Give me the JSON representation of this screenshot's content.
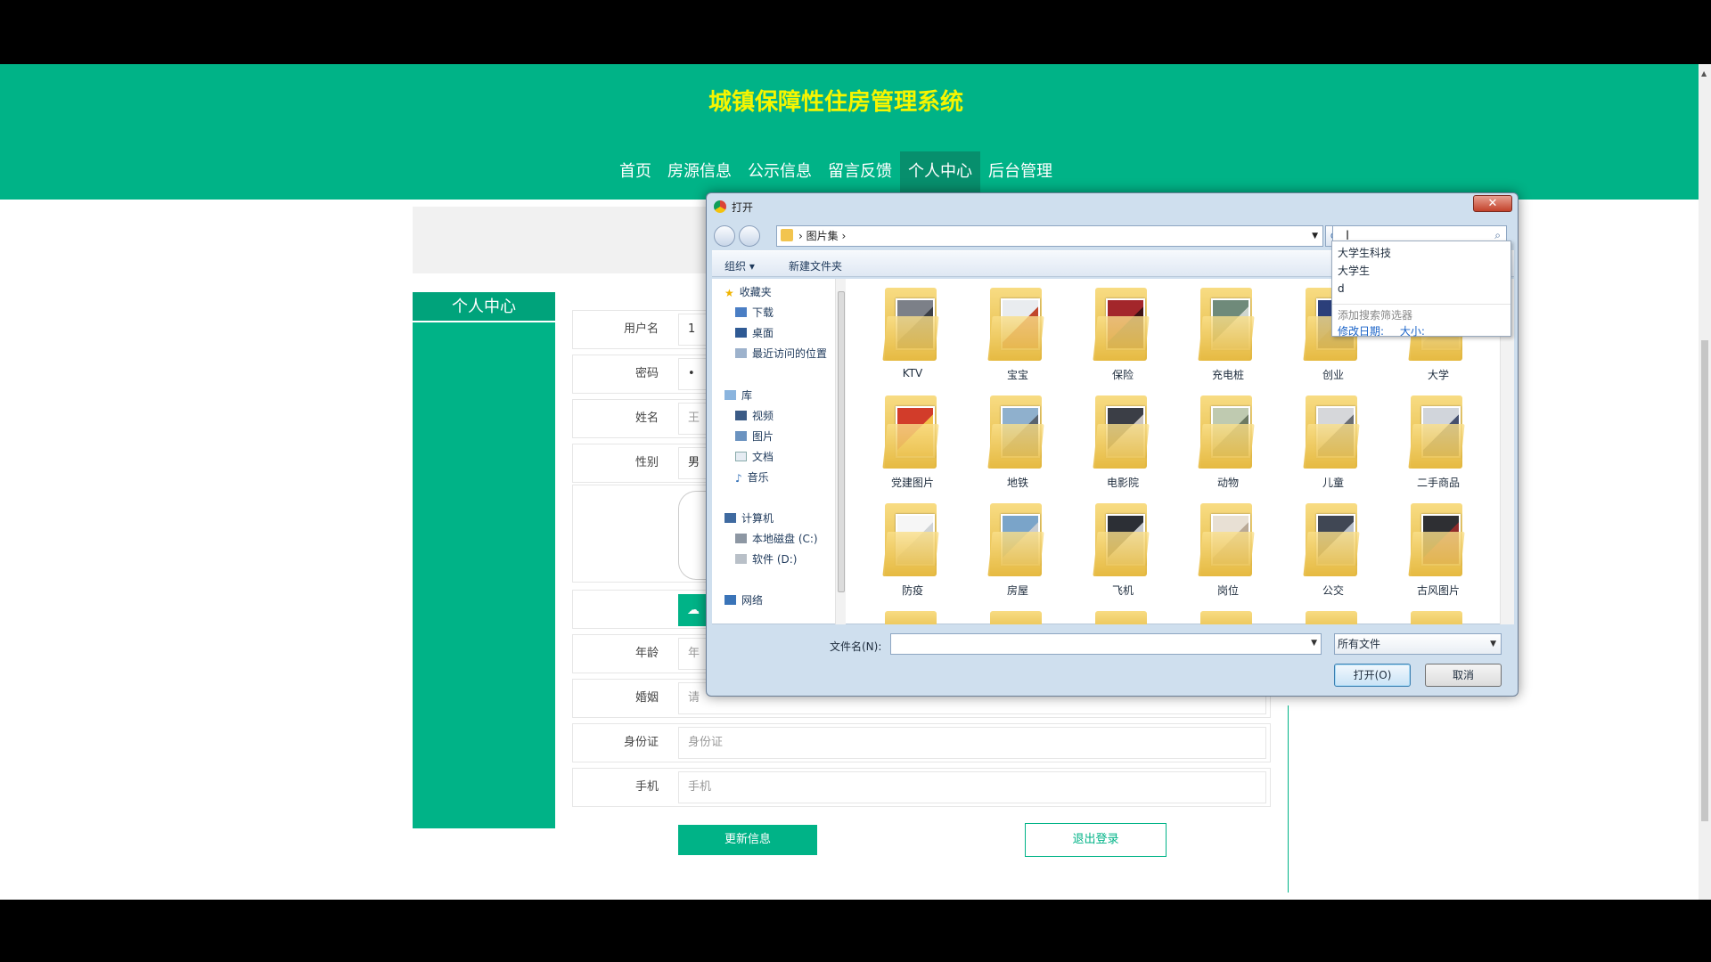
{
  "site": {
    "title": "城镇保障性住房管理系统",
    "nav": [
      "首页",
      "房源信息",
      "公示信息",
      "留言反馈",
      "个人中心",
      "后台管理"
    ]
  },
  "sidebar": {
    "title": "个人中心"
  },
  "form": {
    "rows": [
      {
        "label": "用户名",
        "value": "1"
      },
      {
        "label": "密码",
        "value": "•"
      },
      {
        "label": "姓名",
        "value": "王"
      },
      {
        "label": "性别",
        "value": "男"
      },
      {
        "label": "年龄",
        "value": "年"
      },
      {
        "label": "婚姻",
        "value": "请"
      },
      {
        "label": "身份证",
        "value": "身份证"
      },
      {
        "label": "手机",
        "value": "手机"
      }
    ],
    "update_label": "更新信息",
    "logout_label": "退出登录"
  },
  "dialog": {
    "title": "打开",
    "breadcrumb": "图片集",
    "toolbar": {
      "organize": "组织 ▾",
      "new_folder": "新建文件夹"
    },
    "nav_groups": [
      {
        "label": "收藏夹",
        "items": [
          "下载",
          "桌面",
          "最近访问的位置"
        ]
      },
      {
        "label": "库",
        "items": [
          "视频",
          "图片",
          "文档",
          "音乐"
        ]
      },
      {
        "label": "计算机",
        "items": [
          "本地磁盘 (C:)",
          "软件 (D:)"
        ]
      },
      {
        "label": "网络",
        "items": []
      }
    ],
    "files": [
      "KTV",
      "宝宝",
      "保险",
      "充电桩",
      "创业",
      "大学",
      "党建图片",
      "地铁",
      "电影院",
      "动物",
      "儿童",
      "二手商品",
      "防疫",
      "房屋",
      "飞机",
      "岗位",
      "公交",
      "古风图片"
    ],
    "filename_label": "文件名(N):",
    "filetype": "所有文件",
    "open_label": "打开(O)",
    "cancel_label": "取消",
    "suggestions": [
      "大学生科技",
      "大学生",
      "d"
    ],
    "add_filter": "添加搜索筛选器",
    "filter_date": "修改日期:",
    "filter_size": "大小:"
  }
}
